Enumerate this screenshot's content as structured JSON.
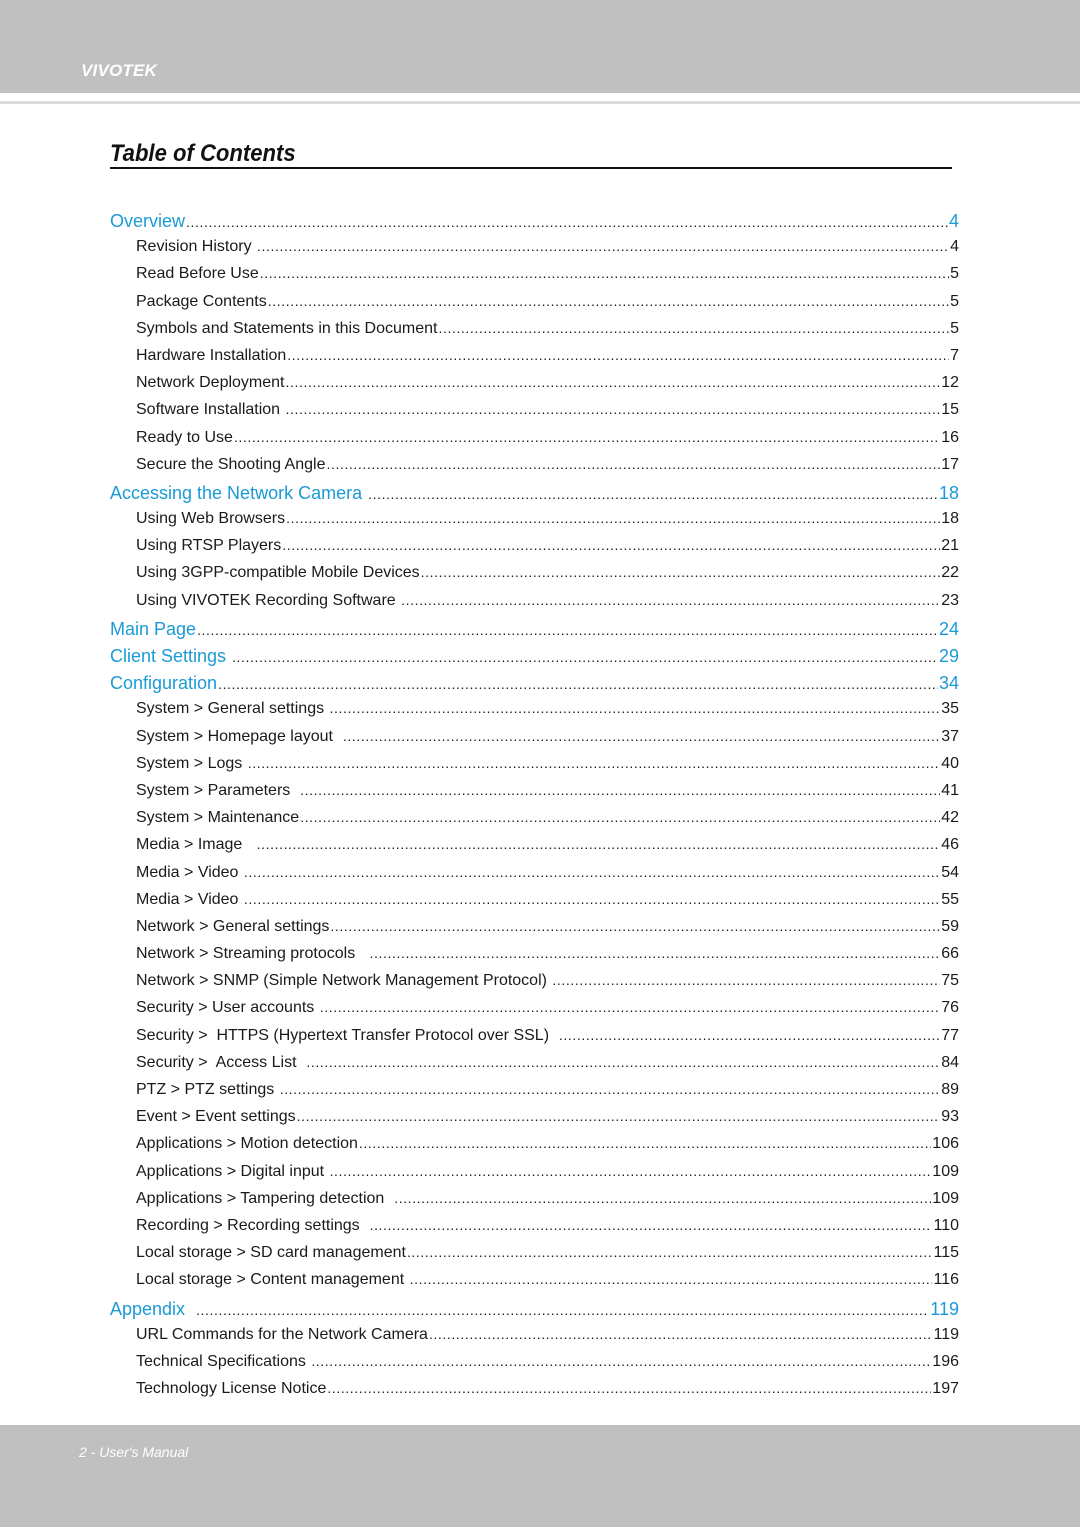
{
  "header": {
    "brand": "VIVOTEK"
  },
  "title": "Table of Contents",
  "colors": {
    "chapter_blue": "#1a9ad6",
    "band_gray": "#bfc0bf"
  },
  "toc": [
    {
      "level": "chapter",
      "label": "Overview",
      "page": "4"
    },
    {
      "level": "section",
      "label": "Revision History ",
      "page": "4"
    },
    {
      "level": "section",
      "label": "Read Before Use",
      "page": "5"
    },
    {
      "level": "section",
      "label": "Package Contents",
      "page": "5"
    },
    {
      "level": "section",
      "label": "Symbols and Statements in this Document",
      "page": "5"
    },
    {
      "level": "section",
      "label": "Hardware Installation",
      "page": "7"
    },
    {
      "level": "section",
      "label": "Network Deployment",
      "page": "12"
    },
    {
      "level": "section",
      "label": "Software Installation ",
      "page": "15"
    },
    {
      "level": "section",
      "label": "Ready to Use",
      "page": "16"
    },
    {
      "level": "section",
      "label": "Secure the Shooting Angle",
      "page": "17"
    },
    {
      "level": "chapter",
      "label": "Accessing the Network Camera ",
      "page": "18"
    },
    {
      "level": "section",
      "label": "Using Web Browsers",
      "page": "18"
    },
    {
      "level": "section",
      "label": "Using RTSP Players",
      "page": "21"
    },
    {
      "level": "section",
      "label": "Using 3GPP-compatible Mobile Devices",
      "page": "22"
    },
    {
      "level": "section",
      "label": "Using VIVOTEK Recording Software ",
      "page": "23"
    },
    {
      "level": "chapter",
      "label": "Main Page",
      "page": "24"
    },
    {
      "level": "chapter",
      "label": "Client Settings ",
      "page": "29"
    },
    {
      "level": "chapter",
      "label": "Configuration",
      "page": "34"
    },
    {
      "level": "section",
      "label": "System > General settings ",
      "page": "35"
    },
    {
      "level": "section",
      "label": "System > Homepage layout  ",
      "page": "37"
    },
    {
      "level": "section",
      "label": "System > Logs ",
      "page": "40"
    },
    {
      "level": "section",
      "label": "System > Parameters  ",
      "page": "41"
    },
    {
      "level": "section",
      "label": "System > Maintenance",
      "page": "42"
    },
    {
      "level": "section",
      "label": "Media > Image   ",
      "page": "46"
    },
    {
      "level": "section",
      "label": "Media > Video ",
      "page": "54"
    },
    {
      "level": "section",
      "label": "Media > Video ",
      "page": "55"
    },
    {
      "level": "section",
      "label": "Network > General settings",
      "page": "59"
    },
    {
      "level": "section",
      "label": "Network > Streaming protocols   ",
      "page": "66"
    },
    {
      "level": "section",
      "label": "Network > SNMP (Simple Network Management Protocol) ",
      "page": "75"
    },
    {
      "level": "section",
      "label": "Security > User accounts ",
      "page": "76"
    },
    {
      "level": "section",
      "label": "Security >  HTTPS (Hypertext Transfer Protocol over SSL)  ",
      "page": "77"
    },
    {
      "level": "section",
      "label": "Security >  Access List  ",
      "page": "84"
    },
    {
      "level": "section",
      "label": "PTZ > PTZ settings ",
      "page": "89"
    },
    {
      "level": "section",
      "label": "Event > Event settings",
      "page": "93"
    },
    {
      "level": "section",
      "label": "Applications > Motion detection",
      "page": "106"
    },
    {
      "level": "section",
      "label": "Applications > Digital input ",
      "page": "109"
    },
    {
      "level": "section",
      "label": "Applications > Tampering detection  ",
      "page": "109"
    },
    {
      "level": "section",
      "label": "Recording > Recording settings  ",
      "page": "110"
    },
    {
      "level": "section",
      "label": "Local storage > SD card management",
      "page": "115"
    },
    {
      "level": "section",
      "label": "Local storage > Content management ",
      "page": "116"
    },
    {
      "level": "chapter",
      "label": "Appendix  ",
      "page": "119"
    },
    {
      "level": "section",
      "label": "URL Commands for the Network Camera",
      "page": "119"
    },
    {
      "level": "section",
      "label": "Technical Specifications ",
      "page": "196"
    },
    {
      "level": "section",
      "label": "Technology License Notice",
      "page": "197"
    }
  ],
  "footer": {
    "page_label": "2 - User's Manual"
  }
}
